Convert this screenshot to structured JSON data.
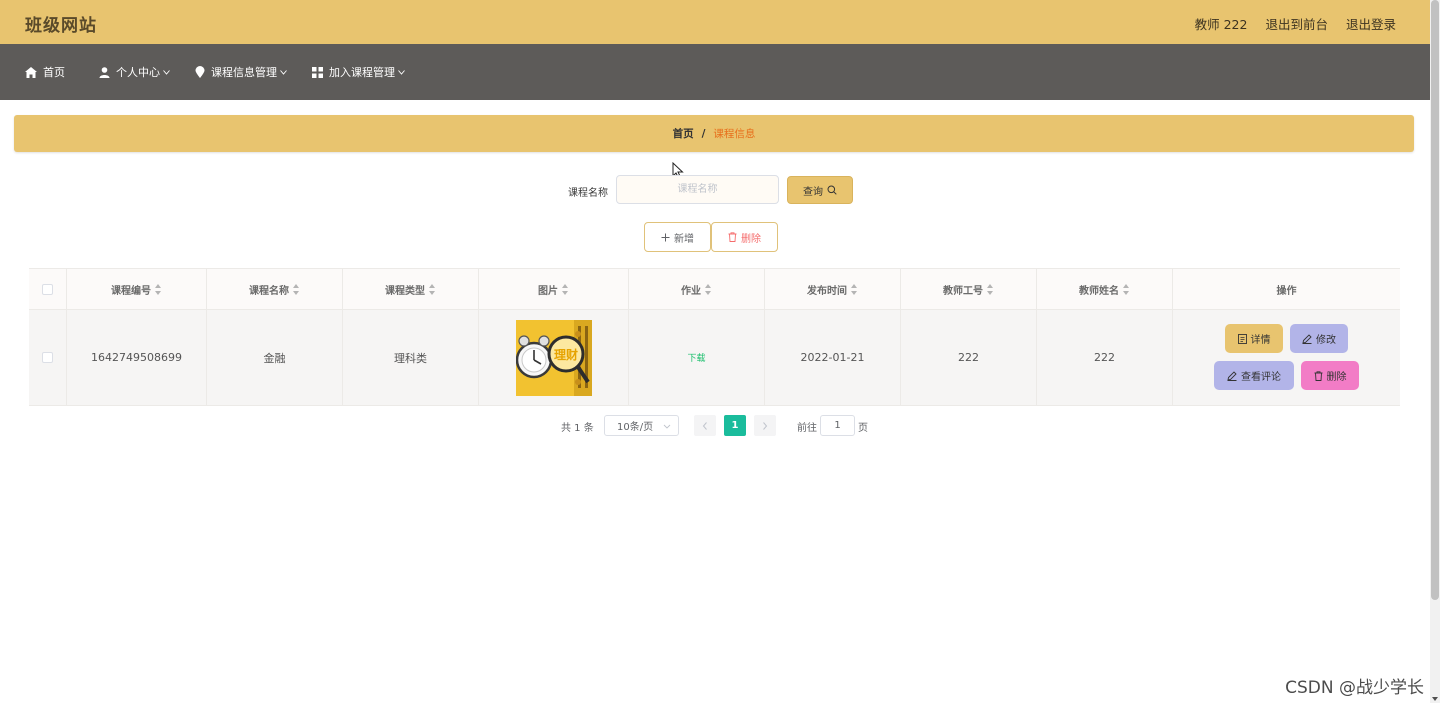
{
  "header": {
    "site_title": "班级网站",
    "user_label": "教师 222",
    "back_to_front": "退出到前台",
    "logout": "退出登录"
  },
  "nav": {
    "items": [
      {
        "label": "首页",
        "icon": "home-icon"
      },
      {
        "label": "个人中心",
        "icon": "user-icon"
      },
      {
        "label": "课程信息管理",
        "icon": "pin-icon"
      },
      {
        "label": "加入课程管理",
        "icon": "grid-icon"
      }
    ]
  },
  "breadcrumb": {
    "home": "首页",
    "separator": "/",
    "current": "课程信息"
  },
  "search": {
    "label": "课程名称",
    "placeholder": "课程名称",
    "value": "",
    "button_label": "查询"
  },
  "actions": {
    "add_label": "新增",
    "delete_label": "删除"
  },
  "table": {
    "columns": [
      "课程编号",
      "课程名称",
      "课程类型",
      "图片",
      "作业",
      "发布时间",
      "教师工号",
      "教师姓名",
      "操作"
    ],
    "rows": [
      {
        "course_id": "1642749508699",
        "course_name": "金融",
        "course_type": "理科类",
        "image_alt": "理财",
        "homework": "下载",
        "publish_date": "2022-01-21",
        "teacher_id": "222",
        "teacher_name": "222",
        "ops": {
          "detail": "详情",
          "edit": "修改",
          "comments": "查看评论",
          "delete": "删除"
        }
      }
    ]
  },
  "pagination": {
    "total_text": "共 1 条",
    "page_size": "10条/页",
    "current_page": "1",
    "goto_label": "前往",
    "goto_value": "1",
    "page_suffix": "页"
  },
  "watermark": "CSDN @战少学长",
  "colors": {
    "header_bg": "#e8c46f",
    "nav_bg": "#5d5b59",
    "accent_orange": "#e76f1c",
    "pager_active": "#1abc9c",
    "op_detail": "#e8c46f",
    "op_edit": "#b2b4e8",
    "op_delete": "#f27cc6"
  }
}
